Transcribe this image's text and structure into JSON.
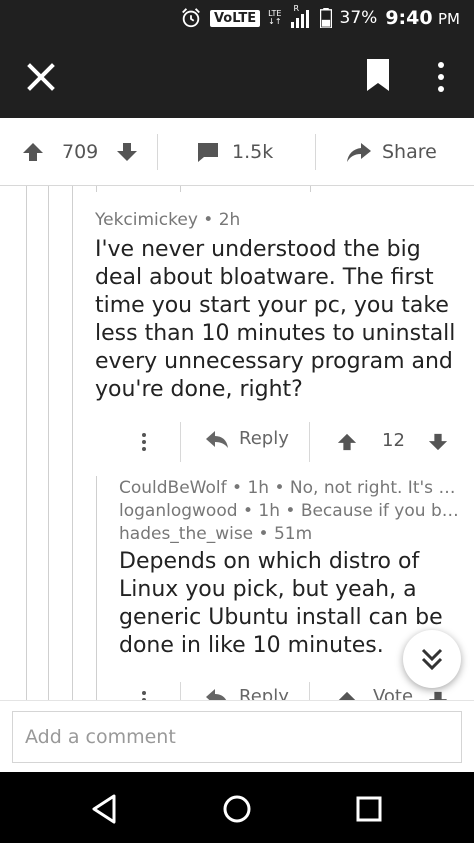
{
  "status_bar": {
    "volte": "VoLTE",
    "lte_top": "LTE",
    "lte_bottom": "↓↑",
    "roaming": "R",
    "battery": "37%",
    "time": "9:40",
    "ampm": "PM"
  },
  "post_actions": {
    "score": "709",
    "comments": "1.5k",
    "share": "Share"
  },
  "comment1": {
    "author": "Yekcimickey",
    "age": "2h",
    "body": "I've never understood the big deal about bloatware. The first time you start your pc, you take less than 10 minutes to uninstall every unnecessary program and you're done, right?",
    "reply_label": "Reply",
    "score": "12"
  },
  "collapsed_replies": [
    {
      "author": "CouldBeWolf",
      "age": "1h",
      "preview": "No, not right. It's no..."
    },
    {
      "author": "loganlogwood",
      "age": "1h",
      "preview": "Because if you buy..."
    }
  ],
  "comment2": {
    "author": "hades_the_wise",
    "age": "51m",
    "body": "Depends on which distro of Linux you pick, but yeah, a generic Ubuntu install can be done in like 10 minutes.",
    "reply_label": "Reply",
    "vote_label": "Vote"
  },
  "comment_box": {
    "placeholder": "Add a comment"
  },
  "colors": {
    "dark_bar": "#202020",
    "icon_gray": "#555555",
    "rail": "#cfcfcf"
  }
}
